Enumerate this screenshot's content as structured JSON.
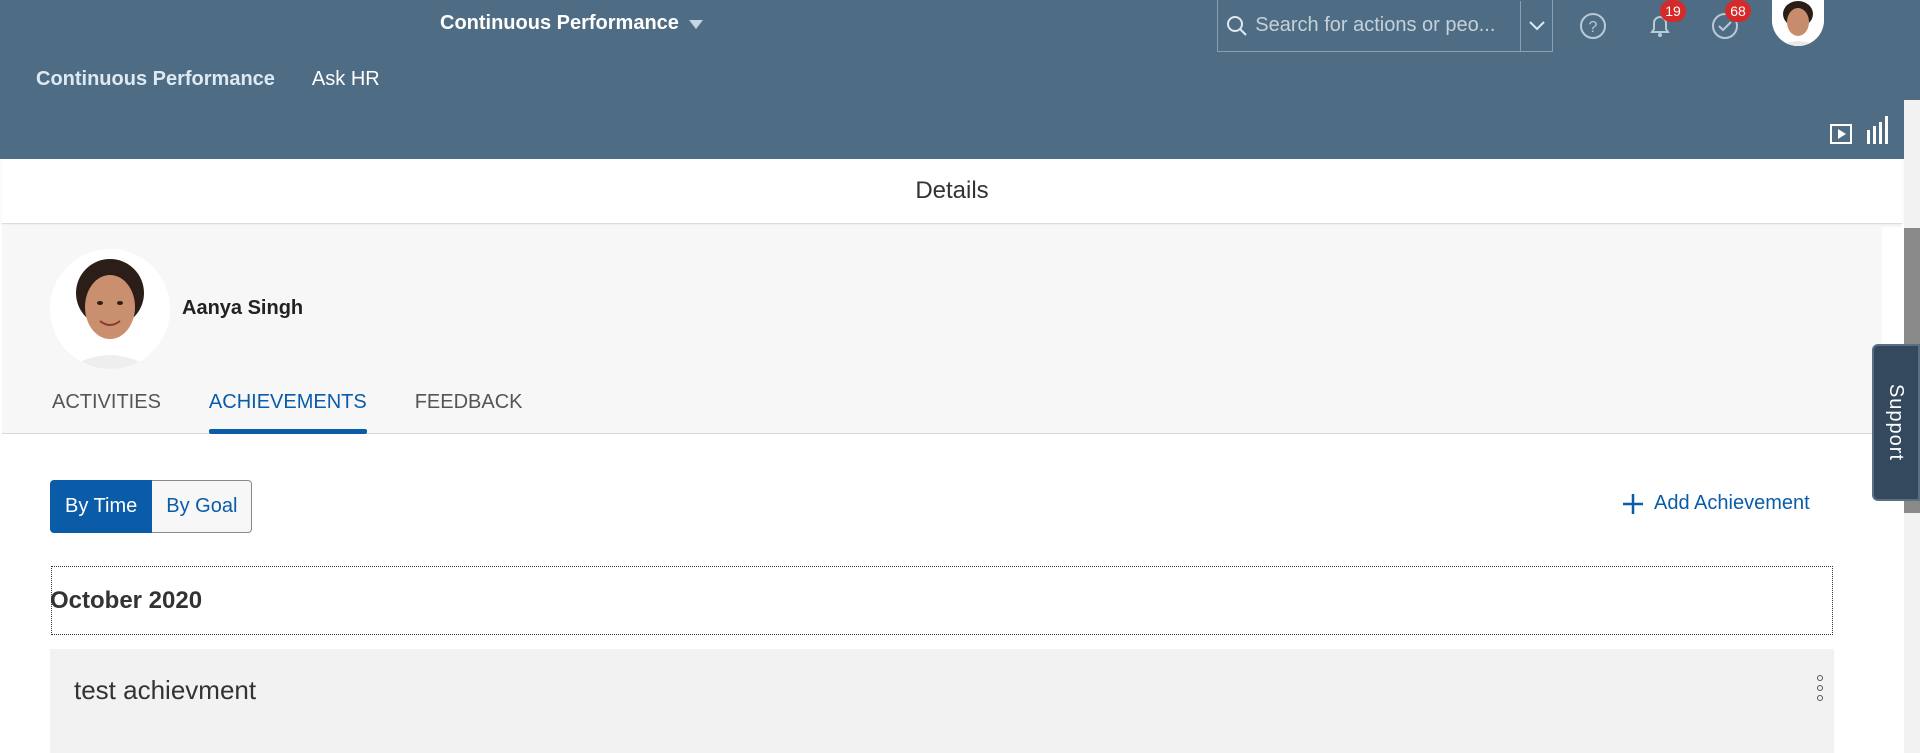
{
  "header": {
    "app_title": "Continuous Performance",
    "search_placeholder": "Search for actions or peo...",
    "notifications_count": "19",
    "tasks_count": "68"
  },
  "nav": {
    "items": [
      {
        "label": "Continuous Performance",
        "active": true
      },
      {
        "label": "Ask HR",
        "active": false
      }
    ]
  },
  "page": {
    "title": "Details"
  },
  "profile": {
    "name": "Aanya Singh",
    "tabs": [
      {
        "label": "ACTIVITIES",
        "active": false
      },
      {
        "label": "ACHIEVEMENTS",
        "active": true
      },
      {
        "label": "FEEDBACK",
        "active": false
      }
    ]
  },
  "content": {
    "view_toggle": [
      {
        "label": "By Time",
        "selected": true
      },
      {
        "label": "By Goal",
        "selected": false
      }
    ],
    "add_label": "Add Achievement",
    "groups": [
      {
        "month": "October 2020",
        "items": [
          {
            "title": "test achievment"
          }
        ]
      }
    ]
  },
  "support": {
    "label": "Support"
  },
  "icons": {
    "search": "search-icon",
    "dropdown": "chevron-down-icon",
    "help": "help-icon",
    "notifications": "bell-icon",
    "tasks": "check-circle-icon",
    "play": "play-icon",
    "chart": "bar-chart-icon",
    "add": "plus-icon",
    "more": "overflow-menu-icon"
  },
  "colors": {
    "shell": "#4e6d84",
    "accent": "#0a5ca8",
    "badge": "#d52a2a"
  }
}
